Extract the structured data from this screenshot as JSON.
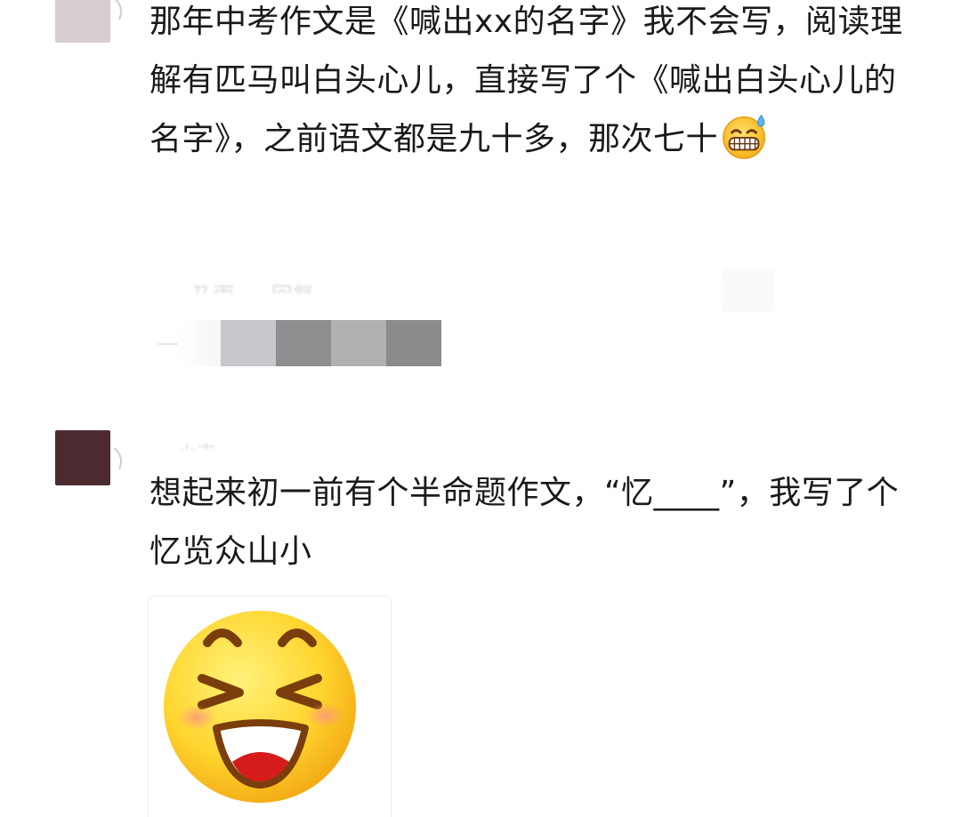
{
  "comments": [
    {
      "text": "那年中考作文是《喊出xx的名字》我不会写，阅读理解有匹马叫白头心儿，直接写了个《喊出白头心儿的名字》，之前语文都是九十多，那次七十",
      "emoji_icon": "grinning-sweat-emoji-icon",
      "avatar_color": "#d7cfcf",
      "meta": {
        "time_blurred": "· 乃雨",
        "reply_blurred": "回复"
      }
    },
    {
      "name_blurred": "· 小卉",
      "text": "想起来初一前有个半命题作文，“忆____”，我写了个忆览众山小",
      "avatar_color": "#4c2b30",
      "sticker_icon": "laughing-squint-emoji-sticker-icon"
    }
  ],
  "liker_blocks": {
    "colors": [
      "#c8c8cc",
      "#8e8e90",
      "#b0b0b3",
      "#8b8b8e"
    ]
  }
}
